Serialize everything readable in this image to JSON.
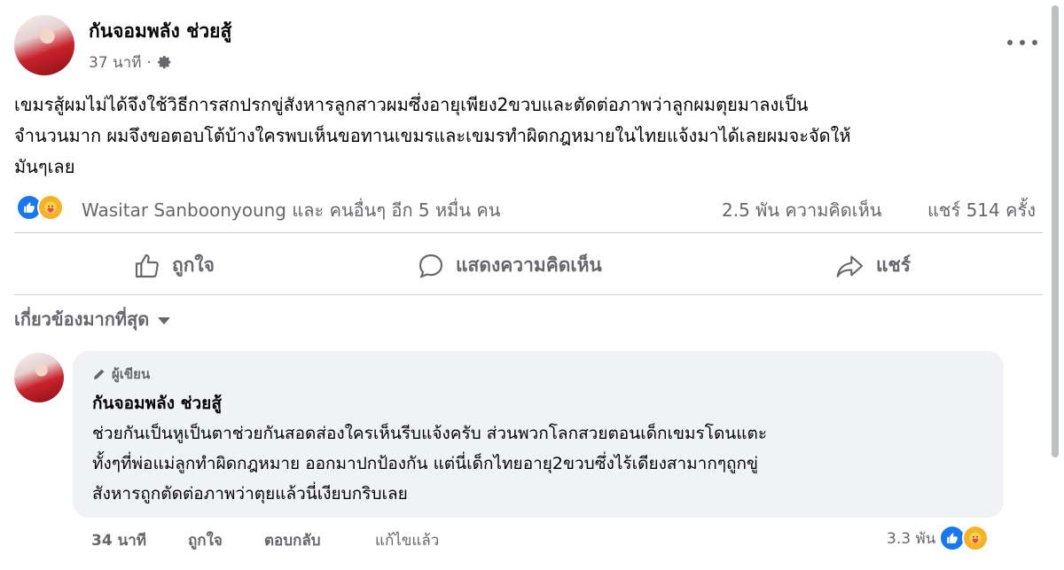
{
  "post": {
    "author": "กันจอมพลัง ช่วยสู้",
    "time": "37 นาที",
    "separator": "·",
    "text_line1": "เขมรสู้ผมไม่ได้จึงใช้วิธีการสกปรกขู่สังหารลูกสาวผมซึ่งอายุเพียง2ขวบและตัดต่อภาพว่าลูกผมตุยมาลงเป็น",
    "text_line2": "จำนวนมาก ผมจึงขอตอบโต้บ้างใครพบเห็นขอทานเขมรและเขมรทำผิดกฎหมายในไทยแจ้งมาได้เลยผมจะจัดให้",
    "text_line3": "มันๆเลย",
    "reactions_text": "Wasitar Sanboonyoung และ คนอื่นๆ อีก 5 หมื่น คน",
    "comments_count": "2.5 พัน ความคิดเห็น",
    "shares_count": "แชร์ 514 ครั้ง"
  },
  "actions": {
    "like": "ถูกใจ",
    "comment": "แสดงความคิดเห็น",
    "share": "แชร์"
  },
  "sort_label": "เกี่ยวข้องมากที่สุด",
  "comment": {
    "badge": "ผู้เขียน",
    "author": "กันจอมพลัง ช่วยสู้",
    "line1": "ช่วยกันเป็นหูเป็นตาช่วยกันสอดส่องใครเห็นรีบแจ้งครับ ส่วนพวกโลกสวยตอนเด็กเขมรโดนแตะ",
    "line2": "ทั้งๆที่พ่อแม่ลูกทำผิดกฎหมาย ออกมาปกป้องกัน แต่นี่เด็กไทยอายุ2ขวบซึ่งไร้เดียงสามากๆถูกขู่",
    "line3": "สังหารถูกตัดต่อภาพว่าตุยแล้วนี่เงียบกริบเลย",
    "time": "34 นาที",
    "like": "ถูกใจ",
    "reply": "ตอบกลับ",
    "edited": "แก้ไขแล้ว",
    "reaction_count": "3.3 พัน"
  },
  "icons": {
    "more": "more-horizontal-icon",
    "privacy": "gear-icon",
    "like": "thumbs-up-icon",
    "comment": "speech-bubble-icon",
    "share": "share-arrow-icon",
    "sort": "caret-down-icon",
    "badge": "pencil-icon"
  },
  "colors": {
    "accent": "#1877f2",
    "care": "#f7b125",
    "muted": "#65676b",
    "bubble": "#f0f2f5"
  }
}
